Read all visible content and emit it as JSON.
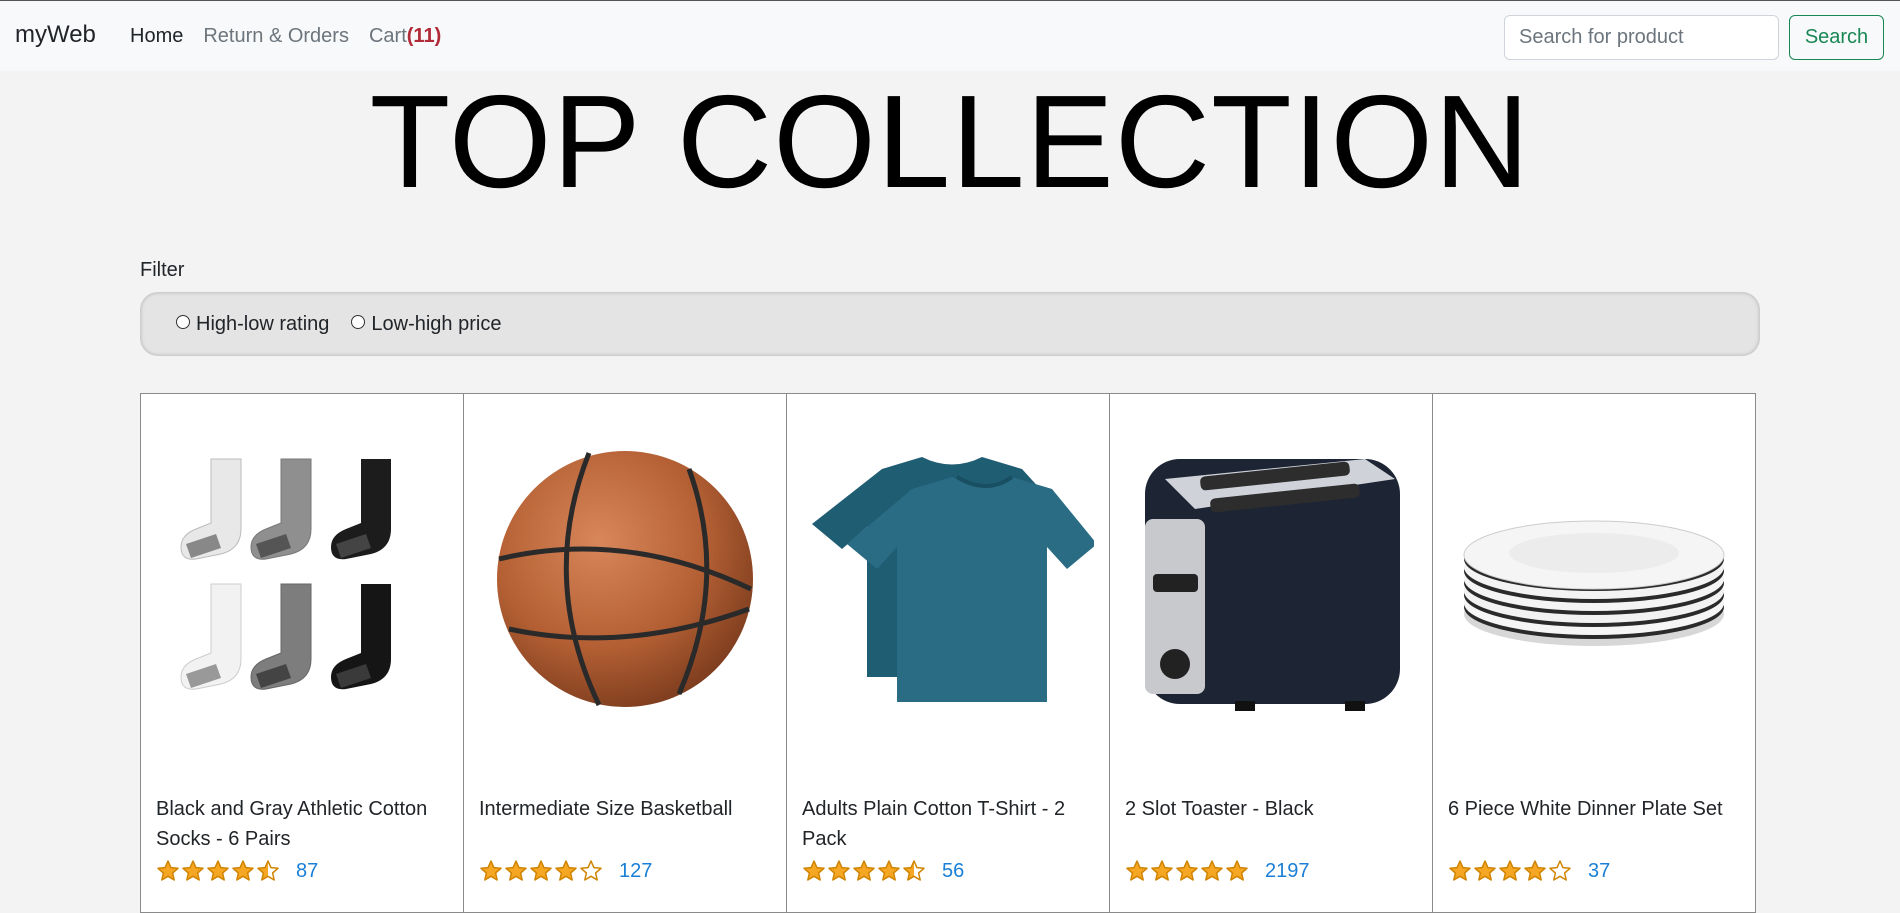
{
  "navbar": {
    "brand": "myWeb",
    "links": [
      {
        "label": "Home"
      },
      {
        "label": "Return & Orders"
      },
      {
        "label": "Cart"
      }
    ],
    "cart_count": "(11)",
    "search_placeholder": "Search for product",
    "search_button": "Search"
  },
  "hero": {
    "title": "TOP COLLECTION"
  },
  "filter": {
    "label": "Filter",
    "options": [
      {
        "label": "High-low rating",
        "selected": false
      },
      {
        "label": "Low-high price",
        "selected": false
      }
    ]
  },
  "products": [
    {
      "title": "Black and Gray Athletic Cotton Socks - 6 Pairs",
      "rating": 4.5,
      "reviews": "87",
      "image": "socks"
    },
    {
      "title": "Intermediate Size Basketball",
      "rating": 4.0,
      "reviews": "127",
      "image": "basketball"
    },
    {
      "title": "Adults Plain Cotton T-Shirt - 2 Pack",
      "rating": 4.5,
      "reviews": "56",
      "image": "tshirt"
    },
    {
      "title": "2 Slot Toaster - Black",
      "rating": 5.0,
      "reviews": "2197",
      "image": "toaster"
    },
    {
      "title": "6 Piece White Dinner Plate Set",
      "rating": 4.0,
      "reviews": "37",
      "image": "plates"
    }
  ],
  "colors": {
    "star": "#f5a623",
    "star_outline": "#d08400",
    "review_link": "#1a7fd6",
    "cart_count": "#b02a37",
    "search_button": "#198754"
  }
}
